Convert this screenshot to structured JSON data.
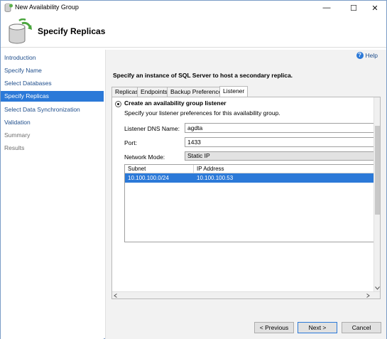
{
  "window": {
    "title": "New Availability Group",
    "minimize_glyph": "—",
    "maximize_glyph": "☐",
    "close_glyph": "✕"
  },
  "header": {
    "title": "Specify Replicas",
    "icon": "database-refresh-icon"
  },
  "sidebar": {
    "items": [
      {
        "label": "Introduction",
        "state": "normal"
      },
      {
        "label": "Specify Name",
        "state": "normal"
      },
      {
        "label": "Select Databases",
        "state": "normal"
      },
      {
        "label": "Specify Replicas",
        "state": "active"
      },
      {
        "label": "Select Data Synchronization",
        "state": "normal"
      },
      {
        "label": "Validation",
        "state": "normal"
      },
      {
        "label": "Summary",
        "state": "disabled"
      },
      {
        "label": "Results",
        "state": "disabled"
      }
    ]
  },
  "main": {
    "help_label": "Help",
    "help_glyph": "?",
    "instruction": "Specify an instance of SQL Server to host a secondary replica.",
    "tabs": [
      {
        "label": "Replicas",
        "active": false
      },
      {
        "label": "Endpoints",
        "active": false
      },
      {
        "label": "Backup Preferences",
        "active": false
      },
      {
        "label": "Listener",
        "active": true
      }
    ],
    "listener": {
      "radio_label": "Create an availability group listener",
      "description": "Specify your listener preferences for this availability group.",
      "dns_label": "Listener DNS Name:",
      "dns_value": "agdta",
      "port_label": "Port:",
      "port_value": "1433",
      "mode_label": "Network Mode:",
      "mode_value": "Static IP",
      "table": {
        "columns": [
          "Subnet",
          "IP Address"
        ],
        "rows": [
          {
            "subnet": "10.100.100.0/24",
            "ip": "10.100.100.53",
            "selected": true
          }
        ]
      }
    }
  },
  "buttons": {
    "previous": "< Previous",
    "next": "Next >",
    "cancel": "Cancel"
  },
  "colors": {
    "accent": "#2b79d8",
    "link": "#1f4e8c",
    "panel_bg": "#f2f2f2"
  }
}
